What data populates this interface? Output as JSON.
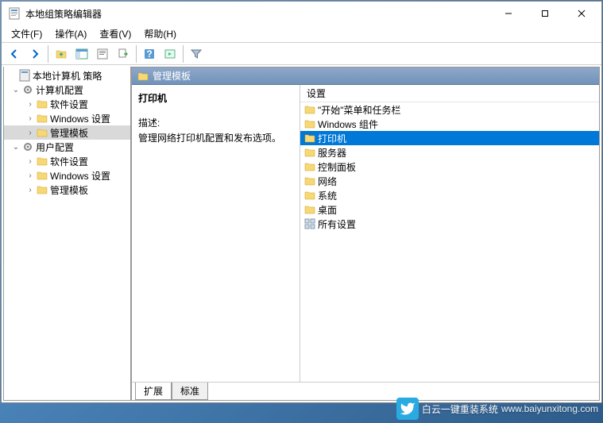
{
  "title": "本地组策略编辑器",
  "menu": {
    "file": "文件(F)",
    "action": "操作(A)",
    "view": "查看(V)",
    "help": "帮助(H)"
  },
  "tree": {
    "root": "本地计算机 策略",
    "computer": {
      "label": "计算机配置",
      "sw": "软件设置",
      "win": "Windows 设置",
      "admin": "管理模板"
    },
    "user": {
      "label": "用户配置",
      "sw": "软件设置",
      "win": "Windows 设置",
      "admin": "管理模板"
    }
  },
  "header": "管理模板",
  "desc": {
    "name": "打印机",
    "descLabel": "描述:",
    "descText": "管理网络打印机配置和发布选项。"
  },
  "listHeader": "设置",
  "items": [
    "\"开始\"菜单和任务栏",
    "Windows 组件",
    "打印机",
    "服务器",
    "控制面板",
    "网络",
    "系统",
    "桌面",
    "所有设置"
  ],
  "tabs": {
    "ext": "扩展",
    "std": "标准"
  },
  "watermark": {
    "text": "白云一键重装系统",
    "url": "www.baiyunxitong.com"
  }
}
